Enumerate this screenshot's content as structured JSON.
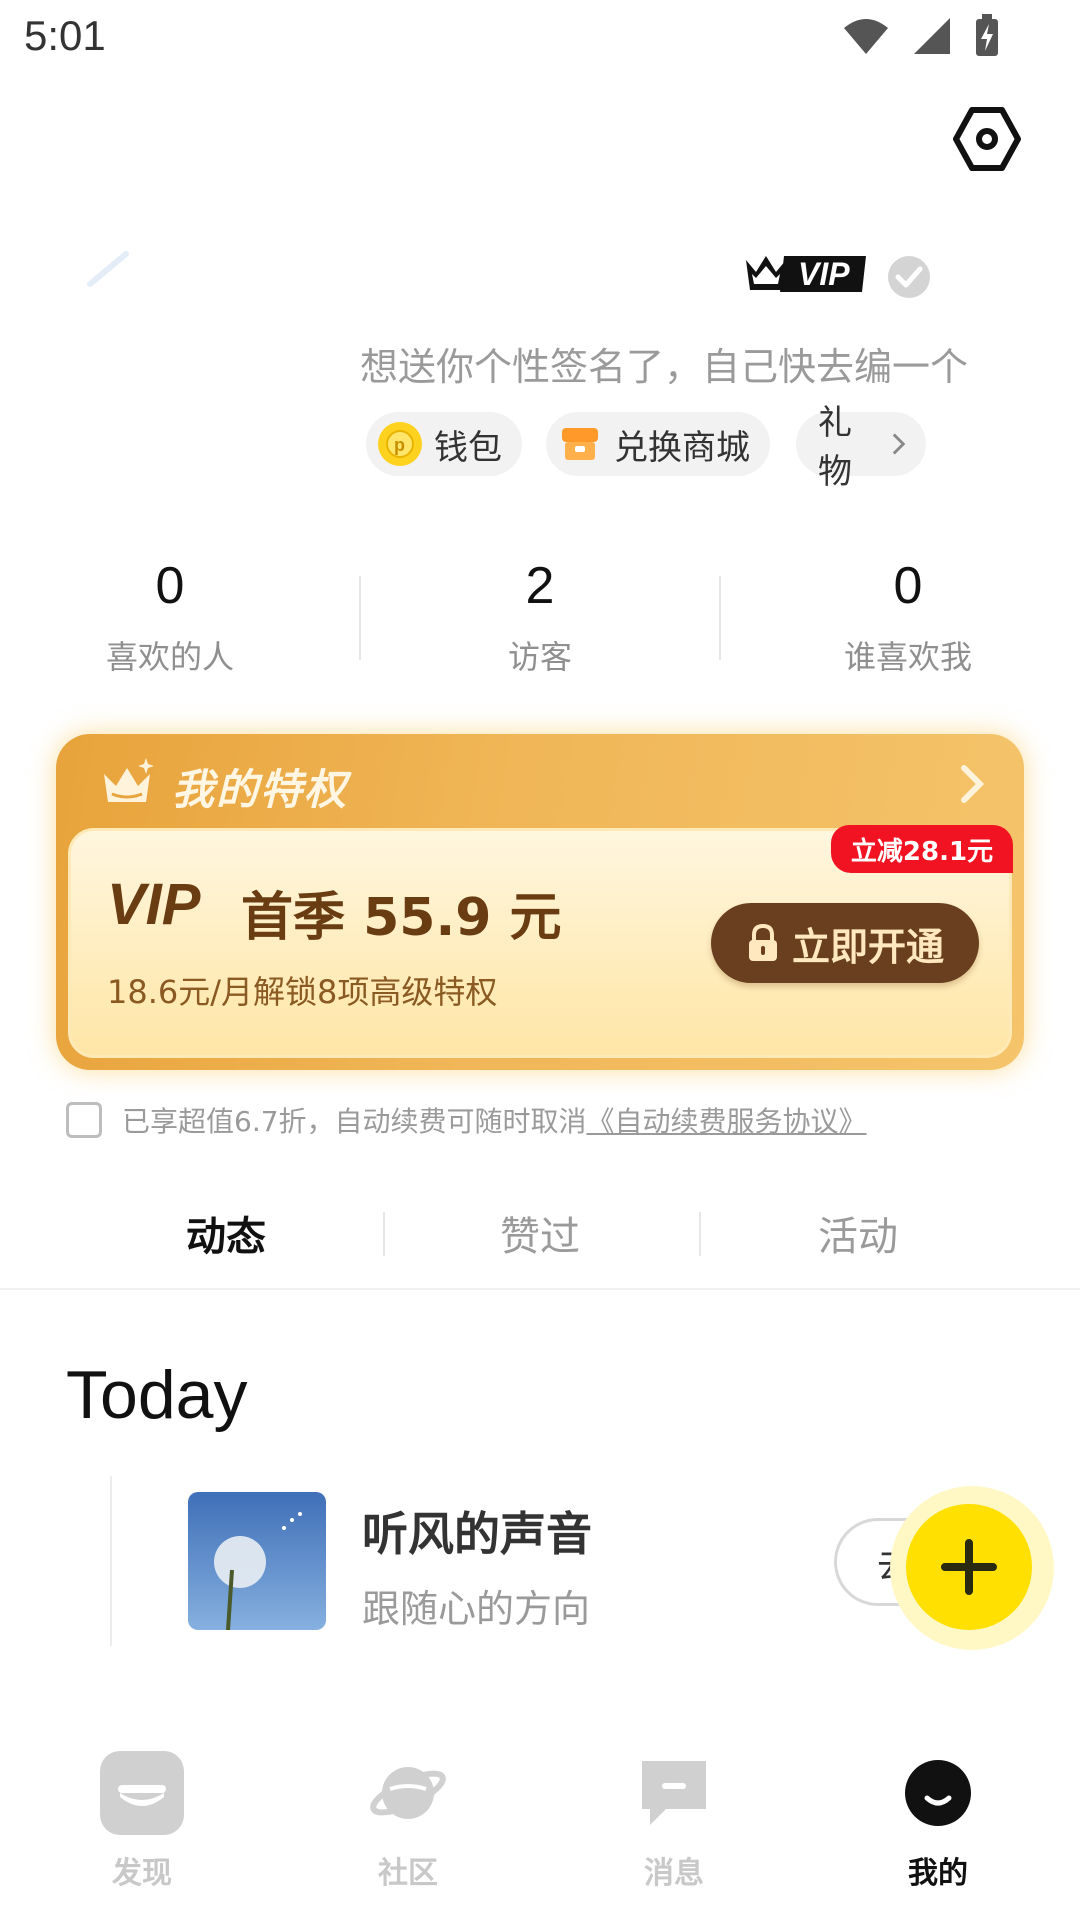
{
  "status_bar": {
    "time": "5:01",
    "icons": [
      "wifi-icon",
      "signal-icon",
      "battery-charging-icon"
    ]
  },
  "profile": {
    "badge_label": "VIP",
    "signature": "想送你个性签名了，自己快去编一个",
    "chips": {
      "wallet": "钱包",
      "shop": "兑换商城",
      "gift": "礼物"
    }
  },
  "stats": [
    {
      "value": "0",
      "label": "喜欢的人"
    },
    {
      "value": "2",
      "label": "访客"
    },
    {
      "value": "0",
      "label": "谁喜欢我"
    }
  ],
  "vip_card": {
    "title": "我的特权",
    "price_brand": "VIP",
    "price_text": "首季 55.9 元",
    "sub_text": "18.6元/月解锁8项高级特权",
    "discount_badge": "立减28.1元",
    "open_button": "立即开通",
    "colors": {
      "card": "#f0b657",
      "button": "#6a3f1f",
      "badge": "#f21322"
    }
  },
  "agreement": {
    "text": "已享超值6.7折，自动续费可随时取消",
    "link": "《自动续费服务协议》"
  },
  "tabs": [
    {
      "label": "动态",
      "active": true
    },
    {
      "label": "赞过",
      "active": false
    },
    {
      "label": "活动",
      "active": false
    }
  ],
  "feed": {
    "section_title": "Today",
    "event": {
      "title": "听风的声音",
      "subtitle": "跟随心的方向",
      "button": "去"
    }
  },
  "fab": {
    "icon": "plus-icon",
    "color": "#ffe000"
  },
  "bottom_nav": [
    {
      "label": "发现",
      "icon": "discover-icon",
      "active": false
    },
    {
      "label": "社区",
      "icon": "planet-icon",
      "active": false
    },
    {
      "label": "消息",
      "icon": "message-icon",
      "active": false
    },
    {
      "label": "我的",
      "icon": "profile-smile-icon",
      "active": true
    }
  ]
}
